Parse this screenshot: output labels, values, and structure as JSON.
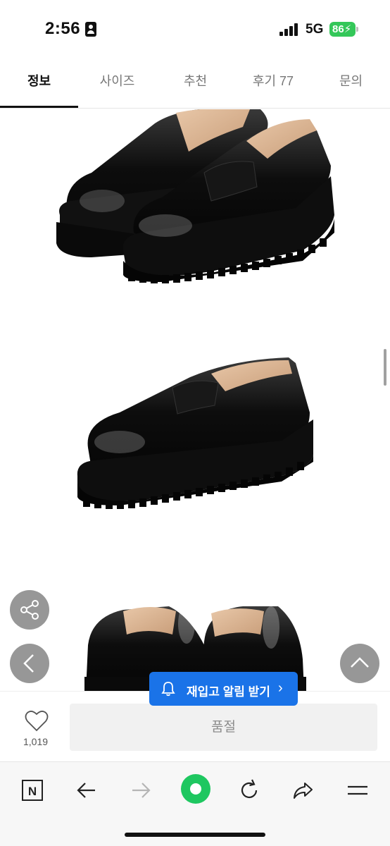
{
  "status_bar": {
    "time": "2:56",
    "network": "5G",
    "battery": "86"
  },
  "tabs": [
    {
      "label": "정보",
      "active": true
    },
    {
      "label": "사이즈",
      "active": false
    },
    {
      "label": "추천",
      "active": false
    },
    {
      "label": "후기 77",
      "active": false
    },
    {
      "label": "문의",
      "active": false
    }
  ],
  "product_images": [
    {
      "icon": "pair-loafers-front-view"
    },
    {
      "icon": "single-loafer-side-view"
    },
    {
      "icon": "pair-loafers-back-view"
    }
  ],
  "floating_buttons": {
    "share": "share-icon",
    "previous": "chevron-left-icon",
    "top": "chevron-up-icon"
  },
  "restock": {
    "label": "재입고 알림 받기",
    "chevron": "›",
    "icon": "bell-icon"
  },
  "buy_bar": {
    "like_count": "1,019",
    "soldout_label": "품절"
  },
  "browser_toolbar": {
    "buttons": [
      "n-logo-icon",
      "back-arrow-icon",
      "forward-arrow-icon",
      "green-dot-icon",
      "reload-icon",
      "share-arrow-icon",
      "menu-icon"
    ]
  },
  "colors": {
    "accent_blue": "#1a73e8",
    "battery_green": "#34c759",
    "green_dot": "#1ec760"
  }
}
